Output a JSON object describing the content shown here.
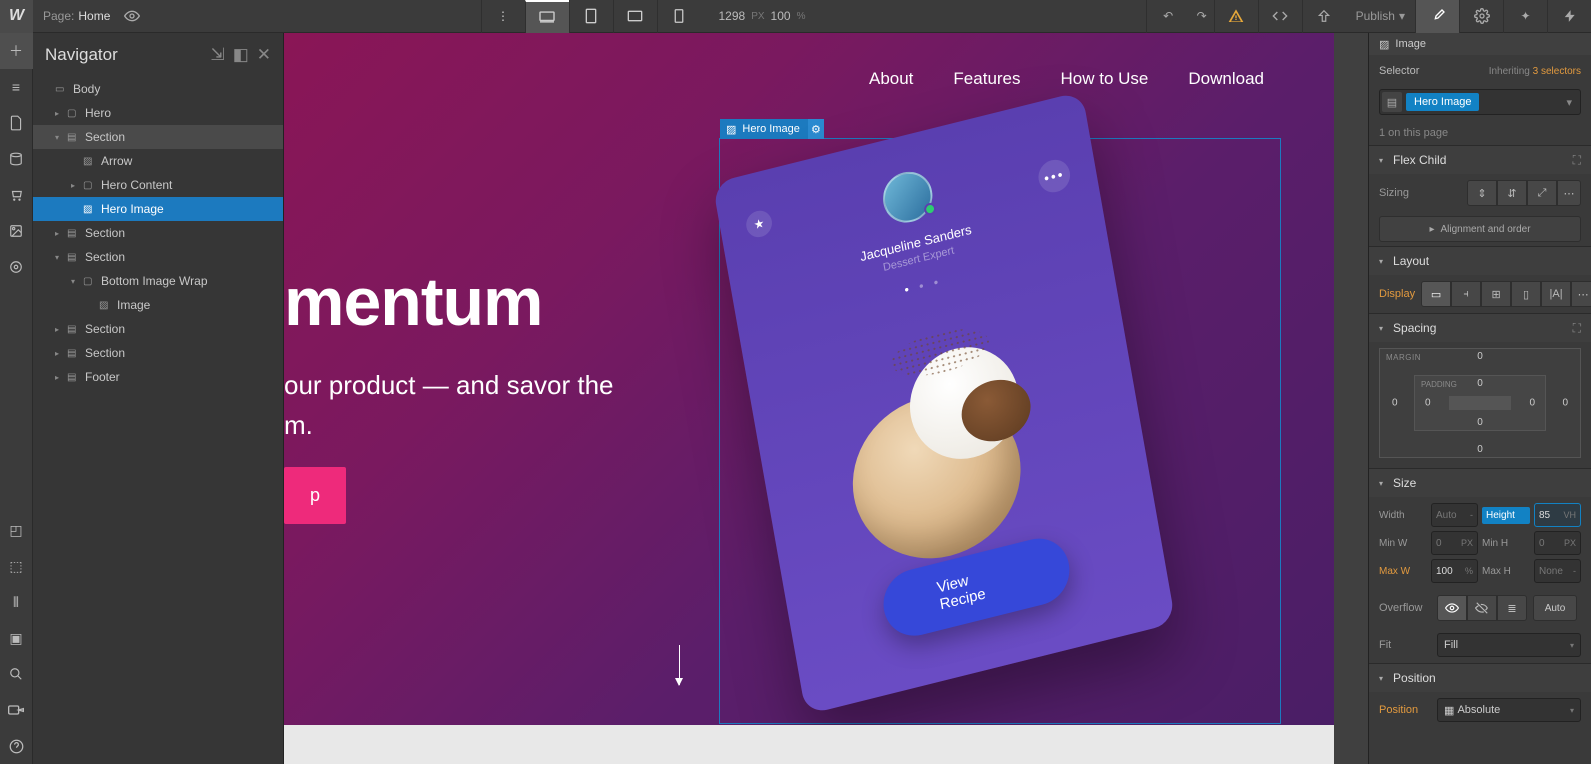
{
  "topbar": {
    "page_label": "Page:",
    "page_name": "Home",
    "canvas_width": "1298",
    "px_unit": "PX",
    "zoom": "100",
    "pct_unit": "%",
    "publish_label": "Publish"
  },
  "navigator": {
    "title": "Navigator",
    "tree": {
      "body": "Body",
      "hero": "Hero",
      "section1": "Section",
      "arrow": "Arrow",
      "hero_content": "Hero Content",
      "hero_image": "Hero Image",
      "section2": "Section",
      "section3": "Section",
      "bottom_wrap": "Bottom Image Wrap",
      "image": "Image",
      "section4": "Section",
      "section5": "Section",
      "footer": "Footer"
    }
  },
  "canvas": {
    "nav": {
      "about": "About",
      "features": "Features",
      "howto": "How to Use",
      "download": "Download"
    },
    "title_fragment": "mentum",
    "sub_line1": "our product — and savor the",
    "sub_line2": "m.",
    "cta_fragment": "p",
    "selection_tag": "Hero Image",
    "mock": {
      "user_name": "Jacqueline Sanders",
      "user_role": "Dessert Expert",
      "view_btn": "View Recipe"
    }
  },
  "style": {
    "element_type": "Image",
    "selector_label": "Selector",
    "inheriting": "Inheriting",
    "inheriting_count": "3 selectors",
    "selector_tag": "Hero Image",
    "on_page": "1 on this page",
    "sections": {
      "flex_child": "Flex Child",
      "layout": "Layout",
      "spacing": "Spacing",
      "size": "Size",
      "position": "Position"
    },
    "flex": {
      "sizing_label": "Sizing",
      "align_order": "Alignment and order"
    },
    "layout": {
      "display_label": "Display"
    },
    "spacing": {
      "margin_label": "MARGIN",
      "padding_label": "PADDING",
      "m_top": "0",
      "m_right": "0",
      "m_bottom": "0",
      "m_left": "0",
      "p_top": "0",
      "p_right": "0",
      "p_bottom": "0",
      "p_left": "0"
    },
    "size": {
      "width_label": "Width",
      "width_val": "Auto",
      "width_unit": "-",
      "height_label": "Height",
      "height_val": "85",
      "height_unit": "VH",
      "minw_label": "Min W",
      "minw_val": "0",
      "minw_unit": "PX",
      "minh_label": "Min H",
      "minh_val": "0",
      "minh_unit": "PX",
      "maxw_label": "Max W",
      "maxw_val": "100",
      "maxw_unit": "%",
      "maxh_label": "Max H",
      "maxh_val": "None",
      "maxh_unit": "-",
      "overflow_label": "Overflow",
      "auto_label": "Auto",
      "fit_label": "Fit",
      "fit_val": "Fill"
    },
    "position": {
      "label": "Position",
      "value": "Absolute"
    }
  }
}
